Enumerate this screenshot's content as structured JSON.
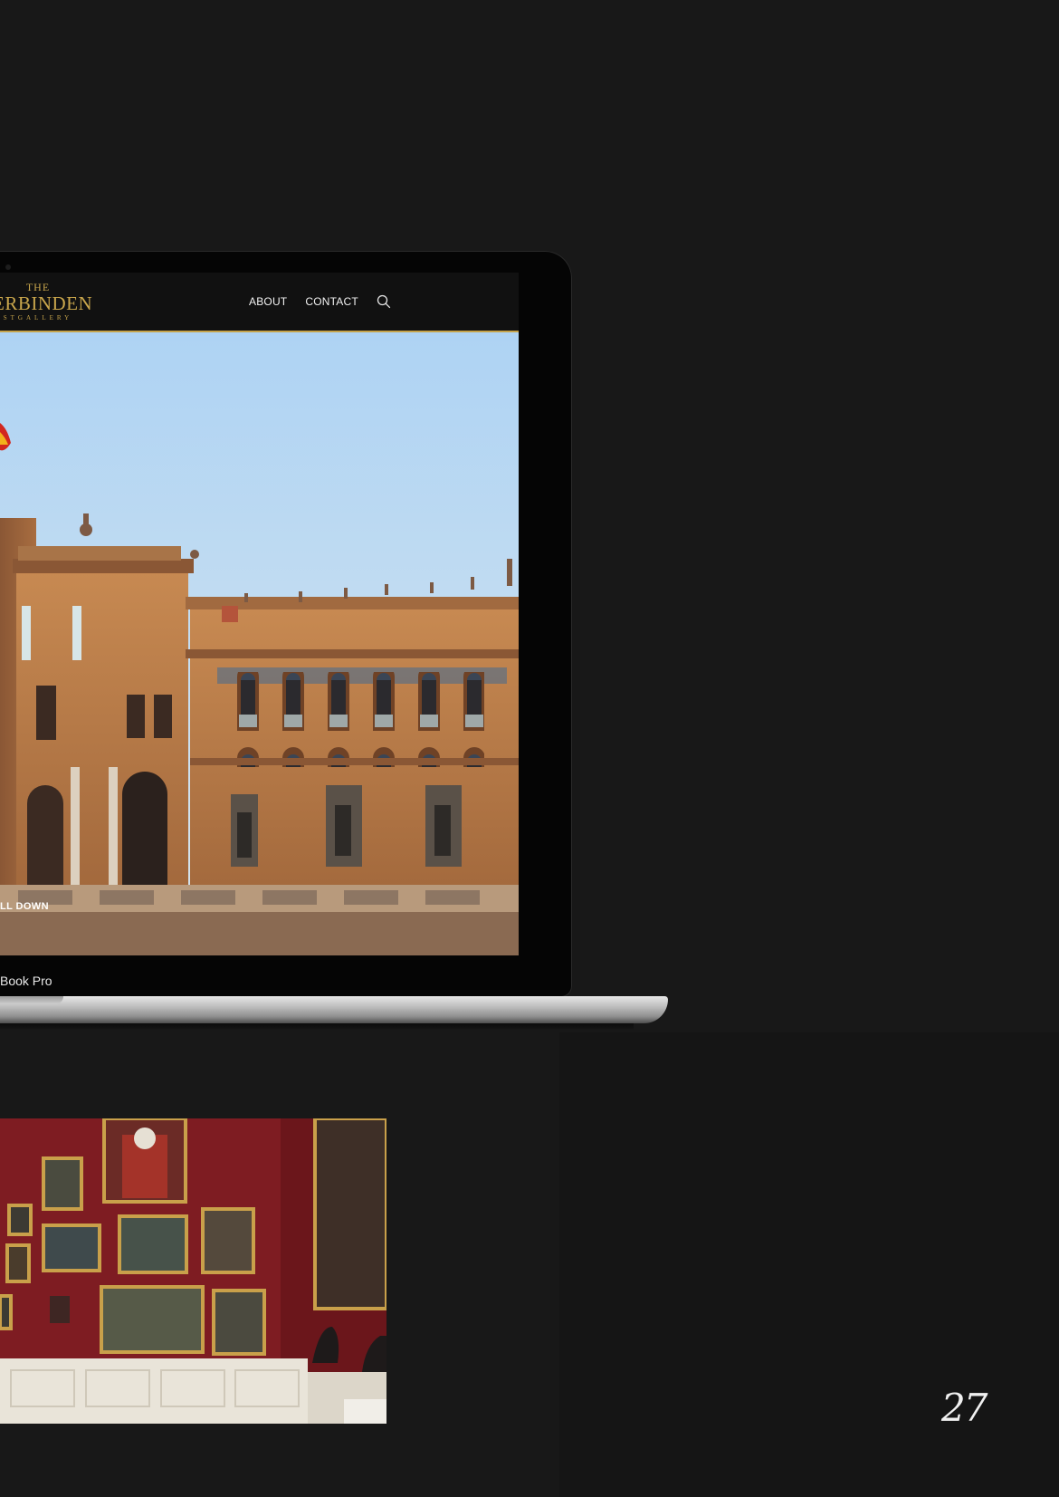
{
  "site": {
    "logo": {
      "top": "THE",
      "main": "ERBINDEN",
      "sub": "STGALLERY"
    },
    "nav": {
      "about": "ABOUT",
      "contact": "CONTACT",
      "search_icon": "search-icon"
    },
    "hero": {
      "scroll_hint": "LL DOWN"
    },
    "accent_color": "#c5a349"
  },
  "device": {
    "label": "Book Pro"
  },
  "page": {
    "number": "27"
  }
}
